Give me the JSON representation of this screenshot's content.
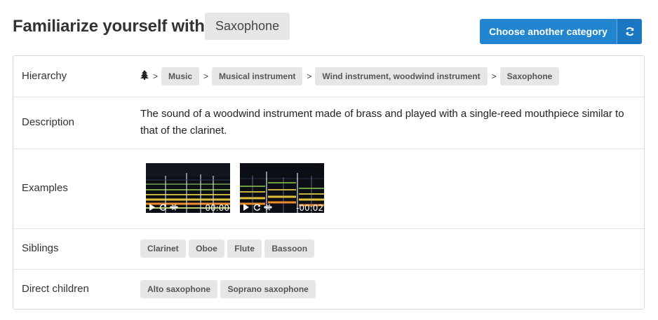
{
  "header": {
    "title": "Familiarize yourself with",
    "category": "Saxophone",
    "choose_button": "Choose another category",
    "refresh_icon": "refresh-icon"
  },
  "rows": {
    "hierarchy": {
      "label": "Hierarchy",
      "root_icon": "tree-icon",
      "separator": ">",
      "items": [
        "Music",
        "Musical instrument",
        "Wind instrument, woodwind instrument",
        "Saxophone"
      ]
    },
    "description": {
      "label": "Description",
      "text": "The sound of a woodwind instrument made of brass and played with a single-reed mouthpiece similar to that of the clarinet."
    },
    "examples": {
      "label": "Examples",
      "players": [
        {
          "time": "-00:00"
        },
        {
          "time": "-00:02"
        }
      ]
    },
    "siblings": {
      "label": "Siblings",
      "items": [
        "Clarinet",
        "Oboe",
        "Flute",
        "Bassoon"
      ]
    },
    "children": {
      "label": "Direct children",
      "items": [
        "Alto saxophone",
        "Soprano saxophone"
      ]
    }
  },
  "colors": {
    "primary_button": "#2185d0",
    "chip_bg": "#e6e6e6",
    "border": "#d9d9d9"
  }
}
